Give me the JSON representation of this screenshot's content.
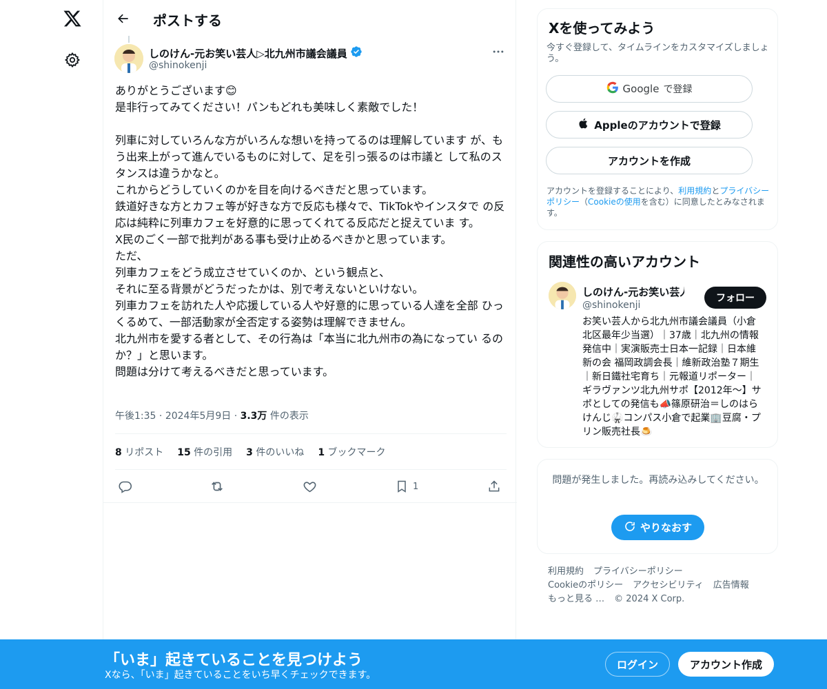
{
  "nav": {
    "logo_icon": "x-logo-icon",
    "settings_icon": "gear-icon"
  },
  "header": {
    "title": "ポストする"
  },
  "post": {
    "author_name": "しのけん-元お笑い芸人▷北九州市議会議員",
    "author_handle": "@shinokenji",
    "verified": true,
    "text": "ありがとうございます😊\n是非行ってみてください！パンもどれも美味しく素敵でした！\n\n列車に対していろんな方がいろんな想いを持ってるのは理解しています が、もう出来上がって進んでいるものに対して、足を引っ張るのは市議と して私のスタンスは違うかなと。\nこれからどうしていくのかを目を向けるべきだと思っています。\n鉄道好きな方とカフェ等が好きな方で反応も様々で、TikTokやインスタで の反応は純粋に列車カフェを好意的に思ってくれてる反応だと捉えていま す。\nX民のごく一部で批判がある事も受け止めるべきかと思っています。\nただ、\n列車カフェをどう成立させていくのか、という観点と、\nそれに至る背景がどうだったかは、別で考えないといけない。\n列車カフェを訪れた人や応援している人や好意的に思っている人達を全部 ひっくるめて、一部活動家が全否定する姿勢は理解できません。\n北九州市を愛する者として、その行為は「本当に北九州市の為になってい るのか？」と思います。\n問題は分けて考えるべきだと思っています。",
    "time": "午後1:35",
    "date": "2024年5月9日",
    "sep": "·",
    "views_count": "3.3万",
    "views_label": "件の表示",
    "stats": [
      {
        "count": "8",
        "label": "リポスト"
      },
      {
        "count": "15",
        "label": "件の引用"
      },
      {
        "count": "3",
        "label": "件のいいね"
      },
      {
        "count": "1",
        "label": "ブックマーク"
      }
    ],
    "actions": {
      "reply_icon": "reply-icon",
      "repost_icon": "repost-icon",
      "like_icon": "heart-icon",
      "bookmark_icon": "bookmark-icon",
      "bookmark_count": "1",
      "share_icon": "share-icon"
    }
  },
  "signup": {
    "title": "Xを使ってみよう",
    "subtitle": "今すぐ登録して、タイムラインをカスタマイズしましょう。",
    "google_brand": "Google",
    "google_suffix": "で登録",
    "apple_label": "Appleのアカウントで登録",
    "create_label": "アカウントを作成",
    "terms_prefix": "アカウントを登録することにより、",
    "terms_link1": "利用規約",
    "terms_and": "と",
    "terms_link2": "プライバシーポリシー",
    "terms_paren_open": "（",
    "terms_link3": "Cookieの使用",
    "terms_suffix": "を含む）に同意したとみなされます。"
  },
  "related": {
    "title": "関連性の高いアカウント",
    "name": "しのけん-元お笑い芸人",
    "handle": "@shinokenji",
    "follow_label": "フォロー",
    "bio": "お笑い芸人から北九州市議会議員（小倉北区最年少当選）｜37歳｜北九州の情報発信中｜実演販売士日本一記録｜日本維新の会 福岡政調会長｜維新政治塾７期生｜新日鐵社宅育ち｜元報道リポーター｜ギラヴァンツ北九州サポ【2012年〜】サポとしての発信も📣篠原研治＝しのはらけんじ🥋コンパス小倉で起業🏢豆腐・プリン販売社長🍮"
  },
  "error": {
    "message": "問題が発生しました。再読み込みしてください。",
    "retry_label": "やりなおす"
  },
  "footer": {
    "links": [
      "利用規約",
      "プライバシーポリシー",
      "Cookieのポリシー",
      "アクセシビリティ",
      "広告情報",
      "もっと見る …"
    ],
    "copyright": "© 2024 X Corp."
  },
  "banner": {
    "title": "「いま」起きていることを見つけよう",
    "subtitle": "Xなら、「いま」起きていることをいち早くチェックできます。",
    "login_label": "ログイン",
    "create_label": "アカウント作成"
  }
}
